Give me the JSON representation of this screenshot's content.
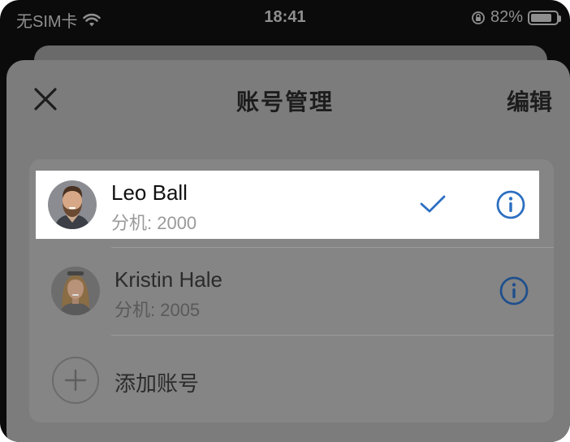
{
  "status_bar": {
    "carrier": "无SIM卡",
    "time": "18:41",
    "battery_percent": "82%",
    "battery_level": 0.82
  },
  "header": {
    "title": "账号管理",
    "edit_label": "编辑"
  },
  "accounts": [
    {
      "name": "Leo Ball",
      "extension": "分机: 2000",
      "selected": true
    },
    {
      "name": "Kristin Hale",
      "extension": "分机: 2005",
      "selected": false
    }
  ],
  "add_account": {
    "label": "添加账号"
  },
  "colors": {
    "accent": "#2d6fc1",
    "accent_dim": "#1f4f8c",
    "overlay_bg": "#7c7c7c",
    "title_text": "#1d1d1d"
  }
}
